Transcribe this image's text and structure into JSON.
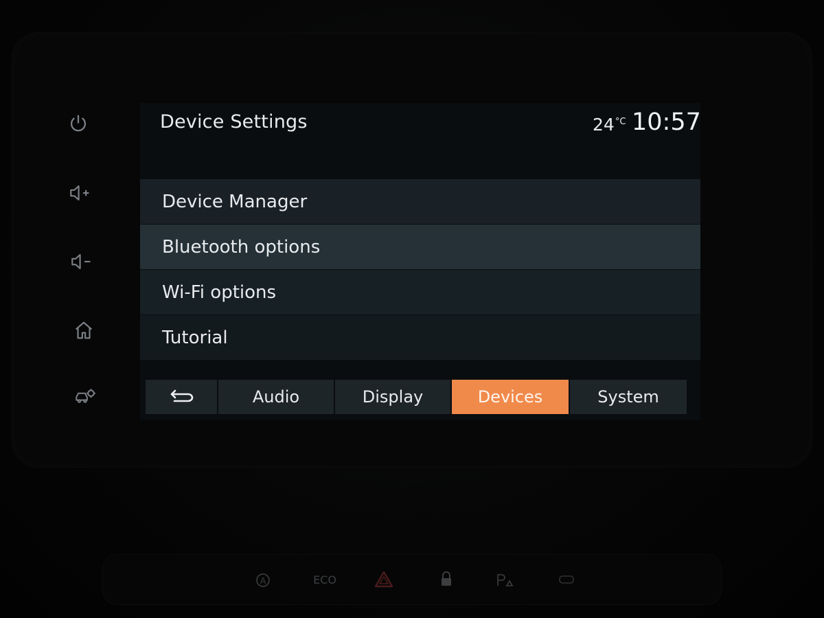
{
  "screen": {
    "title": "Device Settings",
    "temperature_value": "24",
    "temperature_unit": "°C",
    "time": "10:57"
  },
  "menu": {
    "items": [
      {
        "label": "Device Manager"
      },
      {
        "label": "Bluetooth options"
      },
      {
        "label": "Wi-Fi options"
      },
      {
        "label": "Tutorial"
      }
    ]
  },
  "tabs": {
    "back_icon": "back-arrow-icon",
    "items": [
      {
        "label": "Audio",
        "active": false
      },
      {
        "label": "Display",
        "active": false
      },
      {
        "label": "Devices",
        "active": true
      },
      {
        "label": "System",
        "active": false
      }
    ]
  },
  "hardkeys": {
    "icons": [
      "power-icon",
      "volume-up-icon",
      "volume-down-icon",
      "home-icon",
      "car-settings-icon"
    ]
  },
  "console": {
    "eco_label": "ECO",
    "icons": [
      "auto-stop-start-icon",
      "hazard-icon",
      "lock-icon",
      "park-assist-icon",
      "seat-icon"
    ]
  },
  "colors": {
    "accent": "#f08a4b",
    "screen_bg": "#0a0d10",
    "text": "#e8ebee"
  }
}
